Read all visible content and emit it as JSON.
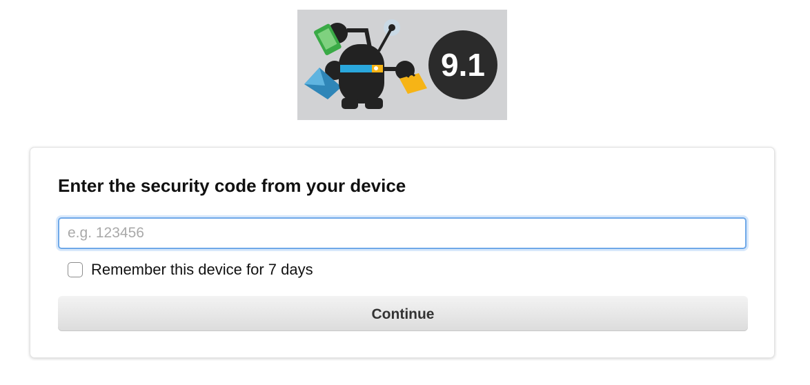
{
  "logo": {
    "version_text": "9.1",
    "icon": "robot-mascot-icon"
  },
  "form": {
    "title": "Enter the security code from your device",
    "code_placeholder": "e.g. 123456",
    "code_value": "",
    "remember_label": "Remember this device for 7 days",
    "remember_checked": false,
    "continue_label": "Continue"
  },
  "colors": {
    "logo_background": "#d1d2d4",
    "focus_border": "#6ea8e8",
    "robot_band": "#2aa7dc",
    "phone": "#3aaa46",
    "folder": "#f6b416",
    "envelope": "#2f86b8",
    "badge": "#2b2b2b"
  }
}
